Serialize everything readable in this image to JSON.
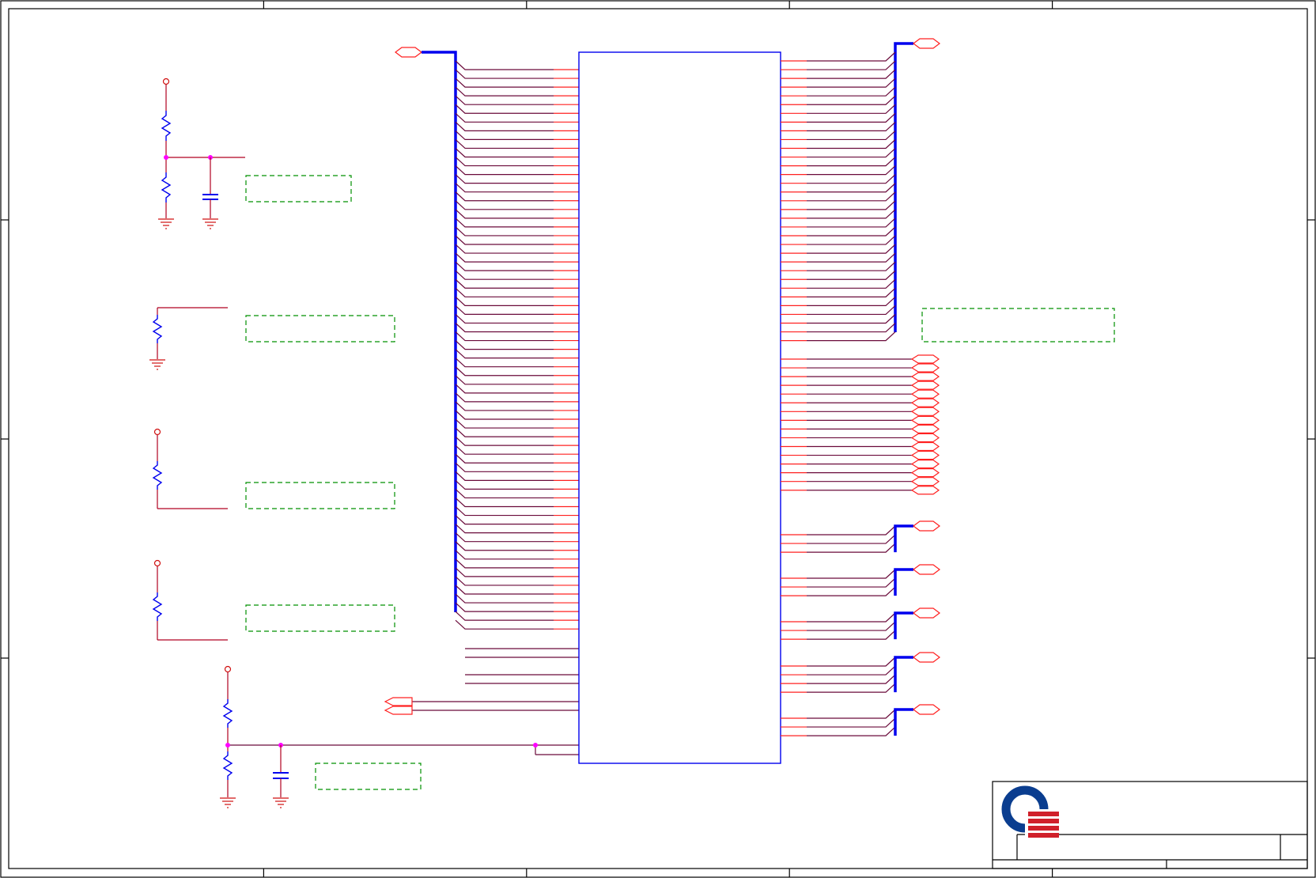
{
  "sheet": {
    "grid_columns": 5,
    "grid_rows": 4
  },
  "colors": {
    "wire": "#b00020",
    "bus": "#0000ee",
    "component": "#0000ee",
    "junction": "#ff00ff",
    "note_box": "#009000",
    "logo_blue": "#0a3d8f",
    "logo_red": "#d0202a"
  },
  "ic": {
    "left_pin_count": 65,
    "right_bus_pin_count": 33,
    "right_signal_count": 16,
    "right_group_counts": [
      3,
      3,
      3,
      4,
      3
    ]
  },
  "title_block": {
    "logo": "company-logo"
  }
}
